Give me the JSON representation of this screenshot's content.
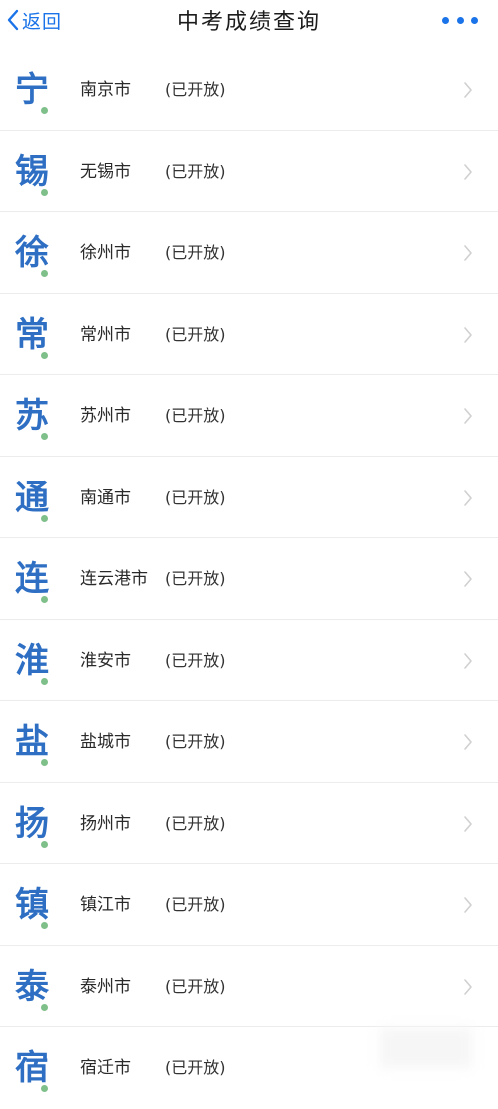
{
  "navbar": {
    "back_label": "返回",
    "title": "中考成绩查询"
  },
  "colors": {
    "accent": "#1a73e8",
    "glyph": "#2e6fc4",
    "dot": "#7fbf8a"
  },
  "cities": [
    {
      "glyph": "宁",
      "name": "南京市",
      "status": "(已开放)"
    },
    {
      "glyph": "锡",
      "name": "无锡市",
      "status": "(已开放)"
    },
    {
      "glyph": "徐",
      "name": "徐州市",
      "status": "(已开放)"
    },
    {
      "glyph": "常",
      "name": "常州市",
      "status": "(已开放)"
    },
    {
      "glyph": "苏",
      "name": "苏州市",
      "status": "(已开放)"
    },
    {
      "glyph": "通",
      "name": "南通市",
      "status": "(已开放)"
    },
    {
      "glyph": "连",
      "name": "连云港市",
      "status": "(已开放)"
    },
    {
      "glyph": "淮",
      "name": "淮安市",
      "status": "(已开放)"
    },
    {
      "glyph": "盐",
      "name": "盐城市",
      "status": "(已开放)"
    },
    {
      "glyph": "扬",
      "name": "扬州市",
      "status": "(已开放)"
    },
    {
      "glyph": "镇",
      "name": "镇江市",
      "status": "(已开放)"
    },
    {
      "glyph": "泰",
      "name": "泰州市",
      "status": "(已开放)"
    },
    {
      "glyph": "宿",
      "name": "宿迁市",
      "status": "(已开放)"
    }
  ]
}
